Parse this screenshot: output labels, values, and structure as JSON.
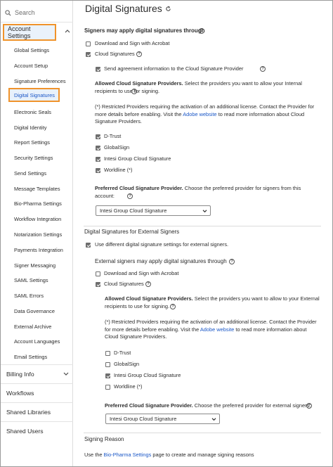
{
  "sidebar": {
    "search_placeholder": "Search",
    "account_settings": "Account Settings",
    "sub_items": [
      "Global Settings",
      "Account Setup",
      "Signature Preferences",
      "Digital Signatures",
      "Electronic Seals",
      "Digital Identity",
      "Report Settings",
      "Security Settings",
      "Send Settings",
      "Message Templates",
      "Bio-Pharma Settings",
      "Workflow Integration",
      "Notarization Settings",
      "Payments Integration",
      "Signer Messaging",
      "SAML Settings",
      "SAML Errors",
      "Data Governance",
      "External Archive",
      "Account Languages",
      "Email Settings"
    ],
    "active_index": 3,
    "top_items": [
      "Billing Info",
      "Workflows",
      "Shared Libraries",
      "Shared Users"
    ]
  },
  "main": {
    "title": "Digital Signatures",
    "signers_heading": "Signers may apply digital signatures through",
    "opt_download_sign": "Download and Sign with Acrobat",
    "opt_cloud": "Cloud Signatures",
    "send_agreement": "Send agreement information to the Cloud Signature Provider",
    "allowed_label": "Allowed Cloud Signature Providers.",
    "allowed_desc": "Select the providers you want to allow your Internal recipients to use for signing.",
    "restricted_pre": "(*) Restricted Providers requiring the activation of an additional license. Contact the Provider for more details before enabling. Visit the",
    "adobe_website": "Adobe website",
    "restricted_post": "to read more information about Cloud Signature Providers.",
    "providers": [
      "D-Trust",
      "GlobalSign",
      "Intesi Group Cloud Signature",
      "Worldline (*)"
    ],
    "internal_checked": [
      true,
      true,
      true,
      true
    ],
    "preferred_label": "Preferred Cloud Signature Provider.",
    "preferred_desc": "Choose the preferred provider for signers from this account:",
    "preferred_value": "Intesi Group Cloud Signature",
    "external_section": "Digital Signatures for External Signers",
    "use_different": "Use different digital signature settings for external signers.",
    "external_heading": "External signers may apply digital signatures through",
    "ext_allowed_desc": "Select the providers you want to allow to your External recipients to use for signing.",
    "ext_restricted_pre": "(*) Restricted Providers requiring the activation of an additional license. Contact the Provider for more details before enabling. Visit the",
    "ext_restricted_post": "to read more information about Cloud Signature Providers.",
    "external_checked": [
      false,
      false,
      true,
      false
    ],
    "ext_preferred_desc": "Choose the preferred provider for external signers:",
    "ext_preferred_value": "Intesi Group Cloud Signature",
    "signing_reason_heading": "Signing Reason",
    "use_the": "Use the",
    "bio_pharma_link": "Bio-Pharma Settings",
    "signing_reason_desc": "page to create and manage signing reasons",
    "help_glyph": "?"
  },
  "colors": {
    "highlight": "#f0932b",
    "link": "#1a57c7",
    "active_bg": "#e8f1fb"
  }
}
